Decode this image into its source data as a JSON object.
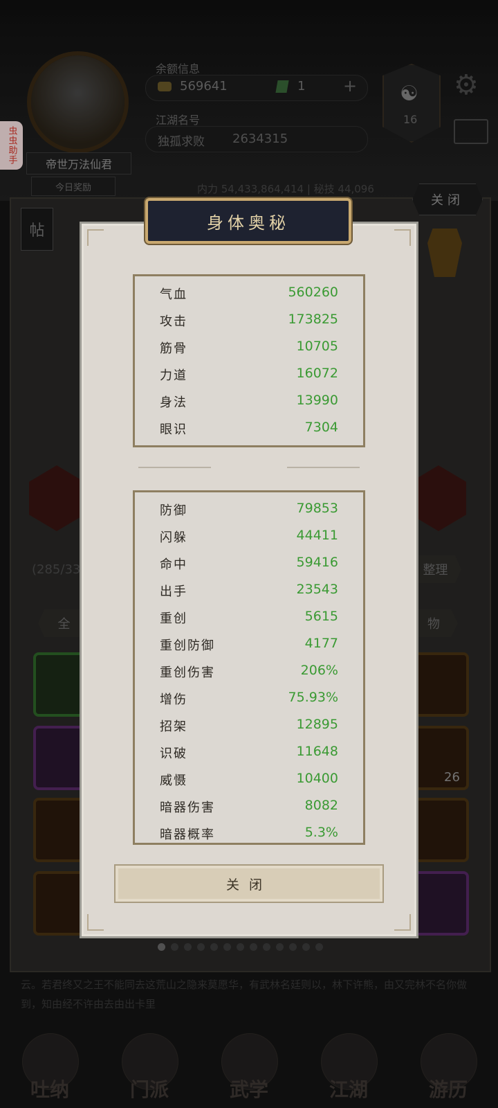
{
  "app": {
    "helper_tab": "虫虫助手"
  },
  "header": {
    "currency_label": "余额信息",
    "gold": "569641",
    "gems": "1",
    "plus": "+",
    "rank_label": "江湖名号",
    "rank_name": "独孤求败",
    "rank_value": "2634315",
    "player_title": "帝世万法仙君",
    "player_tag": "今日奖励",
    "taiji_symbol": "☯",
    "taiji_level": "16",
    "stats_strip": "内力  54,433,864,414  |  秘技  44,096"
  },
  "background": {
    "post_button": "帖",
    "top_close": "关闭",
    "bag_count": "(285/330",
    "sort_button": "整理",
    "filter_all": "全",
    "filter_item": "物",
    "slot_count": "26",
    "story": "云。若君终又之王不能同去这荒山之隐来莫愿华，有武林名廷则以，林下许熊，由又完林不名你做到，知由经不许由去由出卡里",
    "nav": [
      {
        "label": "吐纳",
        "icon": "meditate-icon"
      },
      {
        "label": "门派",
        "icon": "sect-icon"
      },
      {
        "label": "武学",
        "icon": "martial-arts-icon"
      },
      {
        "label": "江湖",
        "icon": "world-icon"
      },
      {
        "label": "游历",
        "icon": "travel-icon"
      }
    ]
  },
  "modal": {
    "title": "身体奥秘",
    "close_label": "关闭",
    "primary_stats": [
      {
        "name": "气血",
        "value": "560260"
      },
      {
        "name": "攻击",
        "value": "173825"
      },
      {
        "name": "筋骨",
        "value": "10705"
      },
      {
        "name": "力道",
        "value": "16072"
      },
      {
        "name": "身法",
        "value": "13990"
      },
      {
        "name": "眼识",
        "value": "7304"
      }
    ],
    "secondary_stats": [
      {
        "name": "防御",
        "value": "79853"
      },
      {
        "name": "闪躲",
        "value": "44411"
      },
      {
        "name": "命中",
        "value": "59416"
      },
      {
        "name": "出手",
        "value": "23543"
      },
      {
        "name": "重创",
        "value": "5615"
      },
      {
        "name": "重创防御",
        "value": "4177"
      },
      {
        "name": "重创伤害",
        "value": "206%"
      },
      {
        "name": "增伤",
        "value": "75.93%"
      },
      {
        "name": "招架",
        "value": "12895"
      },
      {
        "name": "识破",
        "value": "11648"
      },
      {
        "name": "威慑",
        "value": "10400"
      },
      {
        "name": "暗器伤害",
        "value": "8082"
      },
      {
        "name": "暗器概率",
        "value": "5.3%"
      }
    ]
  },
  "colors": {
    "stat_value": "#3a9a33",
    "title_plate": "#1e2230",
    "gold_trim": "#c9a970"
  }
}
